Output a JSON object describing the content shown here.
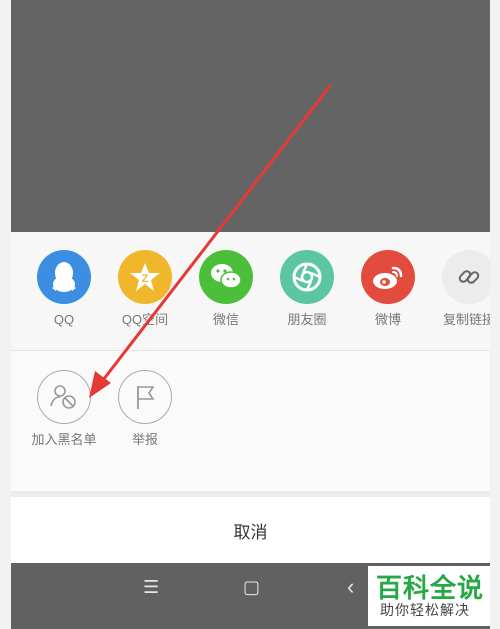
{
  "share": {
    "items": [
      {
        "label": "QQ",
        "icon": "qq-penguin-icon",
        "color": "#3c8fe0"
      },
      {
        "label": "QQ空间",
        "icon": "qzone-star-icon",
        "color": "#f0b72c"
      },
      {
        "label": "微信",
        "icon": "wechat-icon",
        "color": "#4cbf3a"
      },
      {
        "label": "朋友圈",
        "icon": "moments-shutter-icon",
        "color": "#5cc6a1"
      },
      {
        "label": "微博",
        "icon": "weibo-icon",
        "color": "#e34b3f"
      },
      {
        "label": "复制链接",
        "icon": "link-icon",
        "color": "#ececec"
      }
    ]
  },
  "actions": {
    "items": [
      {
        "label": "加入黑名单",
        "icon": "block-user-icon"
      },
      {
        "label": "举报",
        "icon": "report-flag-icon"
      }
    ]
  },
  "cancel_label": "取消",
  "nav": {
    "menu_glyph": "☰",
    "home_glyph": "▢",
    "back_glyph": "‹"
  },
  "watermark": {
    "title": "百科全说",
    "subtitle": "助你轻松解决"
  }
}
